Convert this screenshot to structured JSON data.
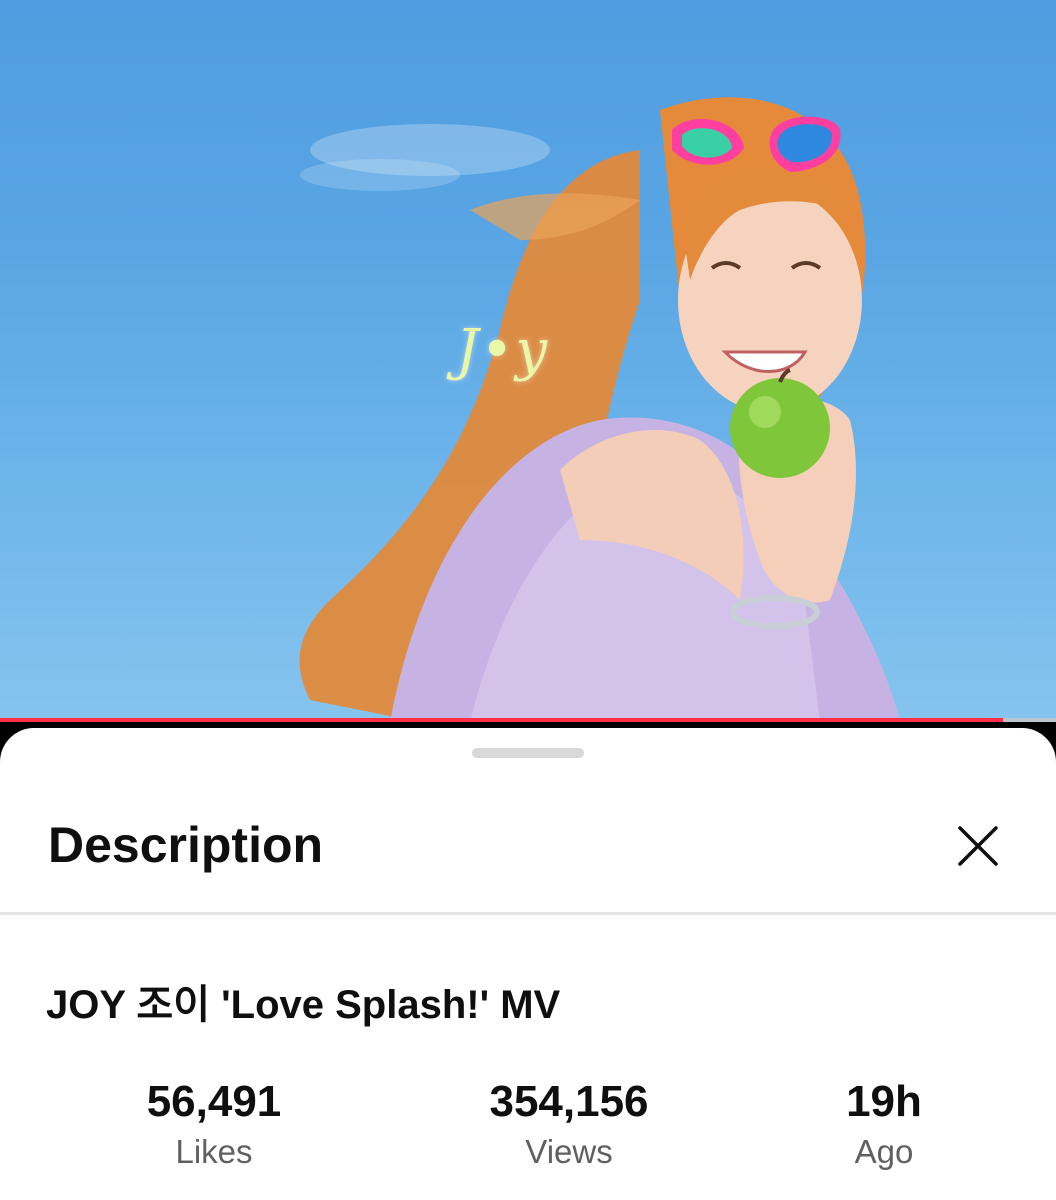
{
  "video": {
    "watermark_text": "J•y",
    "progress": 0.95,
    "colors": {
      "progress_fill": "#ff2d45",
      "sky": "#5aa6e4"
    }
  },
  "sheet": {
    "title": "Description",
    "close_icon": "close-icon",
    "video_title": "JOY 조이 'Love Splash!' MV",
    "stats": [
      {
        "value": "56,491",
        "label": "Likes"
      },
      {
        "value": "354,156",
        "label": "Views"
      },
      {
        "value": "19h",
        "label": "Ago"
      }
    ]
  }
}
